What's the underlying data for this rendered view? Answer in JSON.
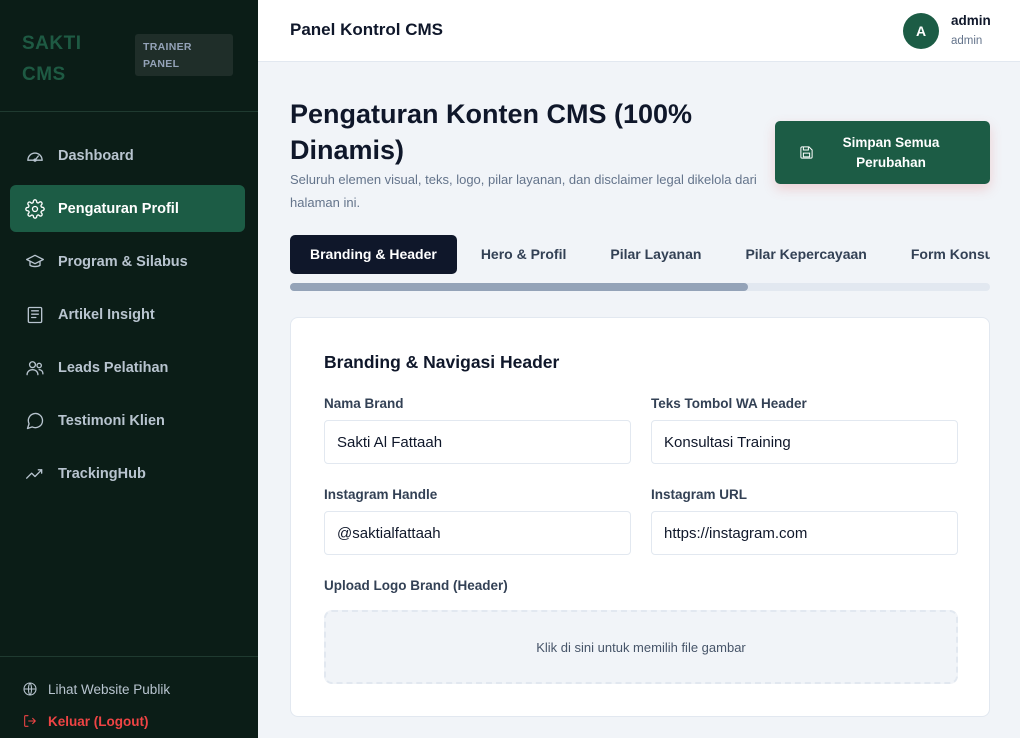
{
  "sidebar": {
    "brand_name": "SAKTI CMS",
    "badge": "TRAINER PANEL",
    "items": [
      {
        "label": "Dashboard",
        "icon": "dashboard-icon",
        "active": false
      },
      {
        "label": "Pengaturan Profil",
        "icon": "gear-icon",
        "active": true
      },
      {
        "label": "Program & Silabus",
        "icon": "graduation-cap-icon",
        "active": false
      },
      {
        "label": "Artikel Insight",
        "icon": "newspaper-icon",
        "active": false
      },
      {
        "label": "Leads Pelatihan",
        "icon": "users-icon",
        "active": false
      },
      {
        "label": "Testimoni Klien",
        "icon": "chat-bubble-icon",
        "active": false
      },
      {
        "label": "TrackingHub",
        "icon": "trend-line-icon",
        "active": false
      }
    ],
    "footer": {
      "public_site": "Lihat Website Publik",
      "logout": "Keluar (Logout)"
    }
  },
  "topbar": {
    "title": "Panel Kontrol CMS",
    "avatar_initial": "A",
    "user_name": "admin",
    "user_role": "admin"
  },
  "main": {
    "title": "Pengaturan Konten CMS (100% Dinamis)",
    "description": "Seluruh elemen visual, teks, logo, pilar layanan, dan disclaimer legal dikelola dari halaman ini.",
    "save_button": "Simpan Semua Perubahan",
    "tabs": [
      {
        "label": "Branding & Header",
        "active": true
      },
      {
        "label": "Hero & Profil",
        "active": false
      },
      {
        "label": "Pilar Layanan",
        "active": false
      },
      {
        "label": "Pilar Kepercayaan",
        "active": false
      },
      {
        "label": "Form Konsultasi",
        "active": false
      }
    ],
    "tab_scroll_fraction": 0.654
  },
  "form": {
    "section_title": "Branding & Navigasi Header",
    "brand_name_label": "Nama Brand",
    "brand_name_value": "Sakti Al Fattaah",
    "wa_button_label": "Teks Tombol WA Header",
    "wa_button_value": "Konsultasi Training",
    "instagram_handle_label": "Instagram Handle",
    "instagram_handle_value": "@saktialfattaah",
    "instagram_url_label": "Instagram URL",
    "instagram_url_value": "https://instagram.com",
    "logo_upload_label": "Upload Logo Brand (Header)",
    "logo_upload_hint": "Klik di sini untuk memilih file gambar"
  },
  "colors": {
    "sidebar_bg": "#0b1d17",
    "accent": "#1c5c45",
    "tab_active": "#0f172a",
    "logout": "#ef4444"
  }
}
